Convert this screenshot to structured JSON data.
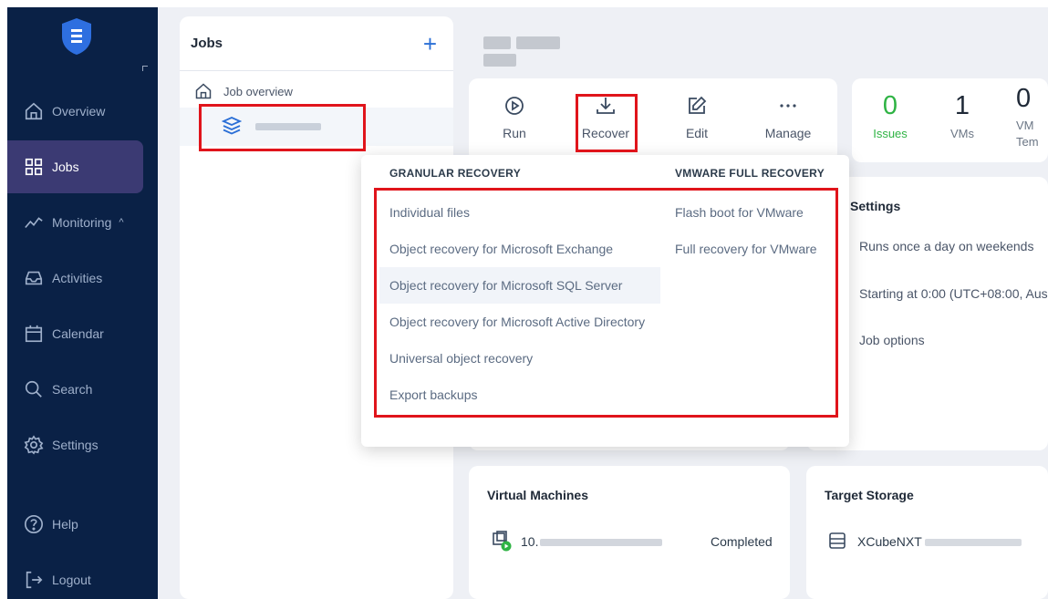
{
  "sidebar": {
    "items": [
      {
        "label": "Overview"
      },
      {
        "label": "Jobs"
      },
      {
        "label": "Monitoring",
        "caret": "^"
      },
      {
        "label": "Activities"
      },
      {
        "label": "Calendar"
      },
      {
        "label": "Search"
      },
      {
        "label": "Settings"
      },
      {
        "label": "Help"
      },
      {
        "label": "Logout"
      }
    ]
  },
  "jobs": {
    "title": "Jobs",
    "add_label": "+",
    "overview_label": "Job overview"
  },
  "toolbar": {
    "run": "Run",
    "recover": "Recover",
    "edit": "Edit",
    "manage": "Manage"
  },
  "stats": [
    {
      "value": "0",
      "label": "Issues",
      "color": "#2fb344"
    },
    {
      "value": "1",
      "label": "VMs"
    },
    {
      "value": "0",
      "label": "VM Tem"
    }
  ],
  "settings": {
    "title": "Settings",
    "schedule": "Runs once a day on weekends",
    "start": "Starting at 0:00 (UTC+08:00, Aus",
    "options": "Job options"
  },
  "vm_card": {
    "title": "Virtual Machines",
    "vm_prefix": "10.",
    "status": "Completed"
  },
  "storage_card": {
    "title": "Target Storage",
    "name_prefix": "XCubeNXT"
  },
  "recover_menu": {
    "granular_title": "GRANULAR RECOVERY",
    "vmware_title": "VMWARE FULL RECOVERY",
    "granular_items": [
      "Individual files",
      "Object recovery for Microsoft Exchange",
      "Object recovery for Microsoft SQL Server",
      "Object recovery for Microsoft Active Directory",
      "Universal object recovery",
      "Export backups"
    ],
    "vmware_items": [
      "Flash boot for VMware",
      "Full recovery for VMware"
    ]
  },
  "colors": {
    "sidebar": "#0a2146",
    "accent": "#2b6fd6",
    "highlight": "#e0141b"
  }
}
